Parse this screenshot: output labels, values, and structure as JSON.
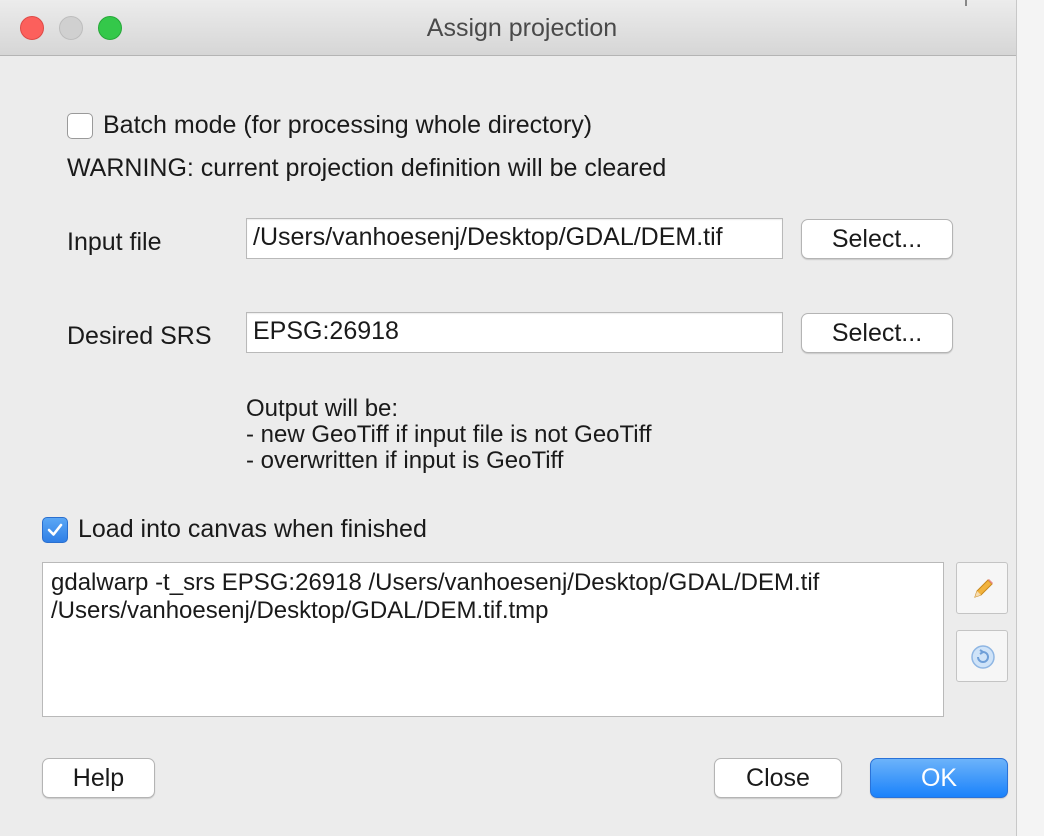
{
  "window": {
    "title": "Assign projection"
  },
  "batch_mode": {
    "label": "Batch mode (for processing whole directory)",
    "checked": false
  },
  "warning": "WARNING: current projection definition will be cleared",
  "input_file": {
    "label": "Input file",
    "value": "/Users/vanhoesenj/Desktop/GDAL/DEM.tif",
    "select_label": "Select..."
  },
  "desired_srs": {
    "label": "Desired SRS",
    "value": "EPSG:26918",
    "select_label": "Select..."
  },
  "output_note": {
    "lines": [
      "Output will be:",
      "- new GeoTiff if input file is not GeoTiff",
      "- overwritten if input is GeoTiff"
    ]
  },
  "load_canvas": {
    "label": "Load into canvas when finished",
    "checked": true
  },
  "command": {
    "lines": [
      "gdalwarp -t_srs EPSG:26918 /Users/vanhoesenj/Desktop/GDAL/DEM.tif",
      "/Users/vanhoesenj/Desktop/GDAL/DEM.tif.tmp"
    ]
  },
  "icons": {
    "edit": "pencil-icon",
    "reset": "reset-icon"
  },
  "buttons": {
    "help": "Help",
    "close": "Close",
    "ok": "OK"
  },
  "colors": {
    "accent": "#1a82fb",
    "close_dot": "#fc605c",
    "zoom_dot": "#34c84a"
  }
}
